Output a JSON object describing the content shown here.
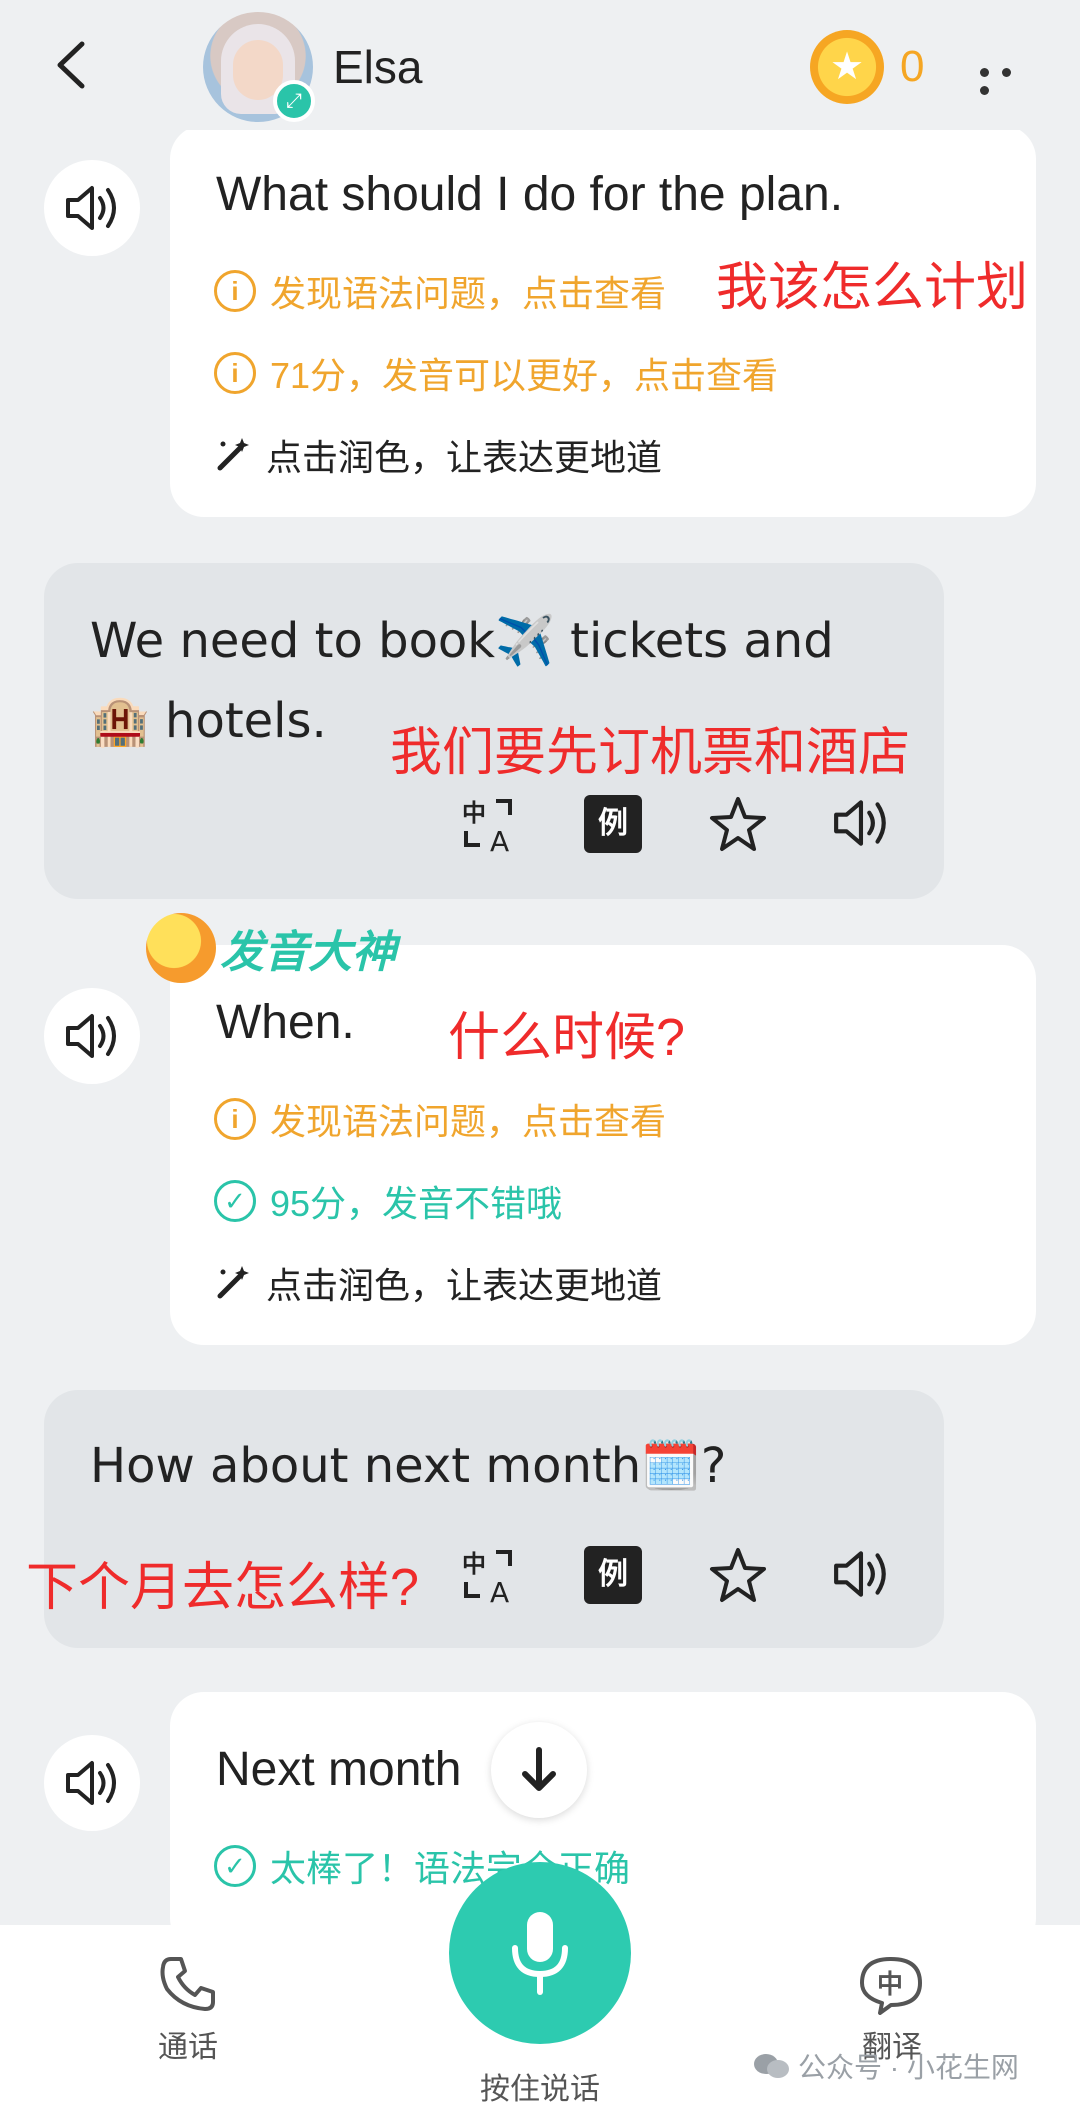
{
  "header": {
    "contact_name": "Elsa",
    "coin_count": "0"
  },
  "messages": [
    {
      "role": "user",
      "sentence": "What should I do for the plan.",
      "grammar_hint": "发现语法问题，点击查看",
      "score_text": "71分，发音可以更好，点击查看",
      "polish_text": "点击润色，让表达更地道"
    },
    {
      "role": "ai",
      "line1": "We need to book✈️ tickets and",
      "line2": "🏨 hotels."
    },
    {
      "role": "user",
      "badge_text": "发音大神",
      "sentence": "When.",
      "grammar_hint": "发现语法问题，点击查看",
      "score_text": "95分，发音不错哦",
      "polish_text": "点击润色，让表达更地道"
    },
    {
      "role": "ai",
      "line1": "How about next month🗓️?"
    },
    {
      "role": "user",
      "sentence": "Next month",
      "grammar_ok": "太棒了！语法完全正确"
    }
  ],
  "tools": {
    "example_label": "例"
  },
  "annotations": {
    "msg1": "我该怎么计划",
    "msg2": "我们要先订机票和酒店",
    "msg3": "什么时候?",
    "msg4": "下个月去怎么样?"
  },
  "bottom": {
    "call_label": "通话",
    "hold_to_talk": "按住说话",
    "translate_label": "翻译",
    "translate_glyph": "中"
  },
  "watermark": "公众号 · 小花生网",
  "colors": {
    "accent": "#2ac4a9",
    "warning": "#f0a52d",
    "annotation": "#ef2b2b",
    "ai_bubble": "#e2e5e8"
  }
}
